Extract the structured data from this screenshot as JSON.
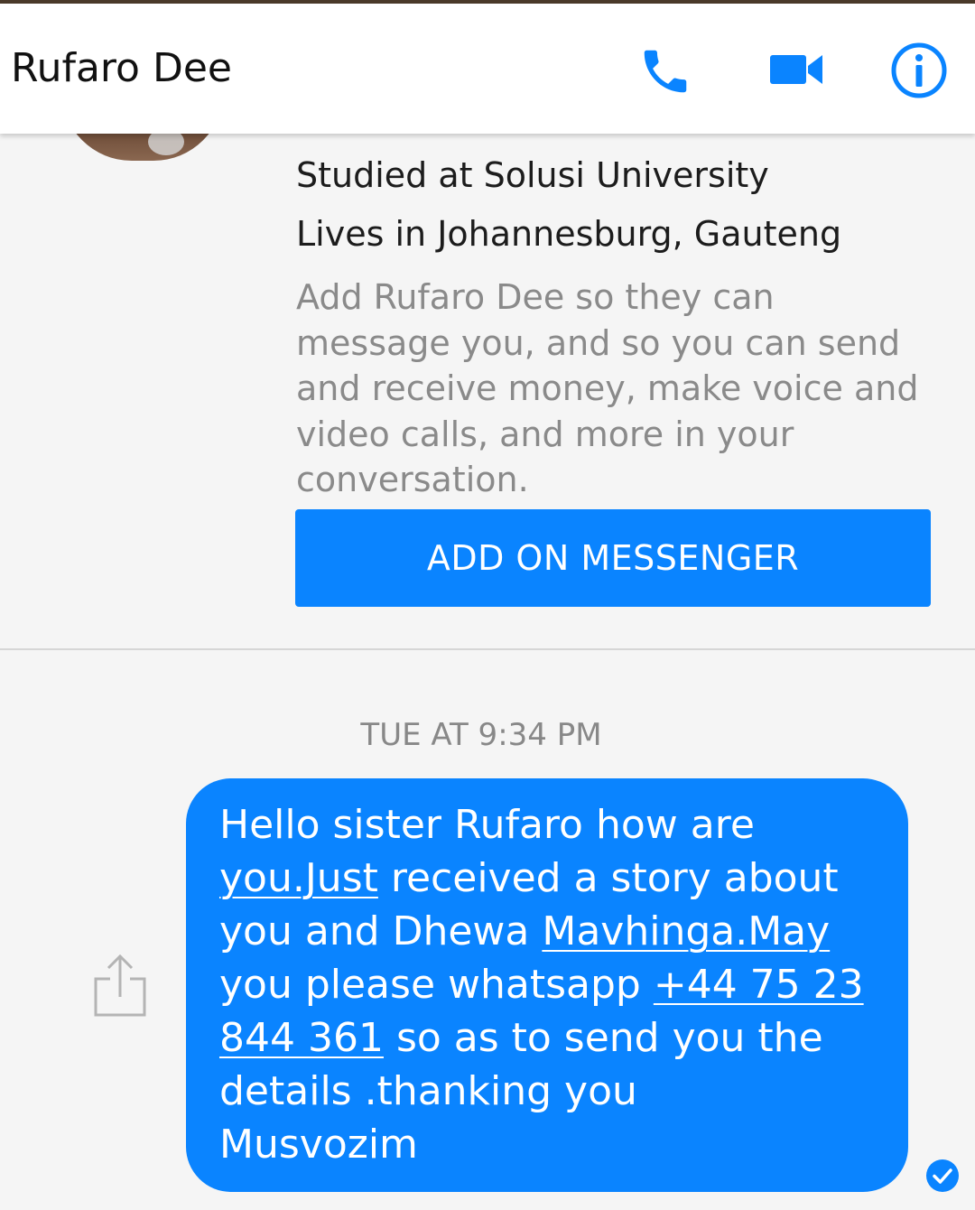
{
  "header": {
    "title": "Rufaro Dee",
    "icons": [
      "phone-icon",
      "video-camera-icon",
      "info-icon"
    ],
    "accent": "#0a84ff"
  },
  "profile": {
    "studied": "Studied at Solusi University",
    "lives": "Lives in Johannesburg, Gauteng",
    "description_lines": [
      "Add Rufaro Dee so they can",
      "message you, and so you can send",
      "and receive money, make voice and",
      "video calls, and more in your",
      "conversation."
    ],
    "add_button": "ADD ON MESSENGER"
  },
  "conversation": {
    "timestamp": "TUE AT 9:34 PM",
    "message": {
      "l1": "Hello sister Rufaro how are",
      "l2_link": "you.Just",
      "l2_rest": " received a story about",
      "l3_pre": "you and Dhewa ",
      "l3_link": "Mavhinga.May",
      "l4_pre": "you please whatsapp ",
      "l4_link": "+44 75 23",
      "l5_link": "844 361",
      "l5_rest": " so as to send you the",
      "l6": "details .thanking you",
      "l7": "Musvozim"
    },
    "status_icon": "delivered-check-icon",
    "share_icon": "share-icon"
  }
}
